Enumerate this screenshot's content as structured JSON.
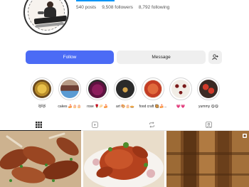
{
  "profile": {
    "stats": {
      "posts": "540 posts",
      "followers": "9,508 followers",
      "following": "8,792 following"
    }
  },
  "actions": {
    "follow_label": "Follow",
    "message_label": "Message",
    "add_user_icon": "⁺⁄"
  },
  "highlights": [
    {
      "label": "😻😻"
    },
    {
      "label": "cakes 🍰🎂🎂"
    },
    {
      "label": "rose 🌹🥟🍰"
    },
    {
      "label": "art 🎨🎂🥧"
    },
    {
      "label": "food craft 🥘🍰..."
    },
    {
      "label": "💗💗"
    },
    {
      "label": "yummy 😋😋"
    }
  ],
  "tabs": [
    {
      "name": "grid",
      "icon": "grid-icon",
      "active": true
    },
    {
      "name": "reels",
      "icon": "reels-icon",
      "active": false
    },
    {
      "name": "reposts",
      "icon": "repost-icon",
      "active": false
    },
    {
      "name": "tagged",
      "icon": "tagged-icon",
      "active": false
    }
  ],
  "colors": {
    "accent": "#4b6bf5",
    "progress": "#0095f6",
    "secondary_button": "#efefef"
  }
}
